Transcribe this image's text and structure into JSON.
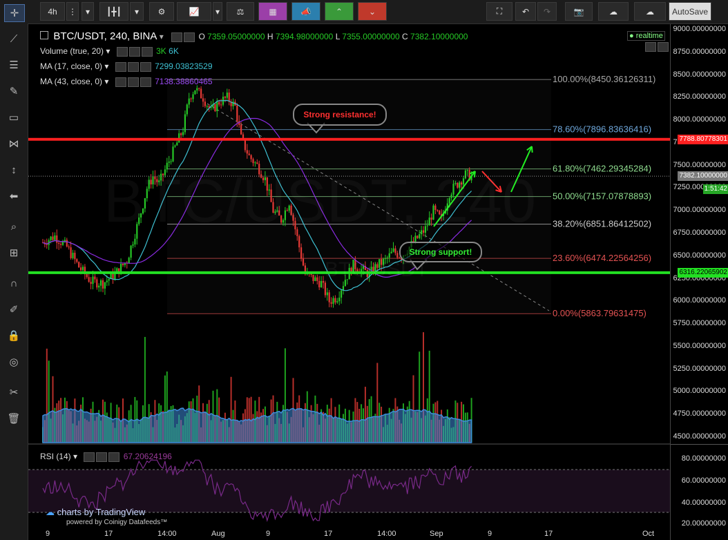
{
  "toolbar": {
    "interval": "4h",
    "autosave": "AutoSave"
  },
  "legend": {
    "symbol": "BTC/USDT, 240, BINA",
    "ohlc": {
      "o_label": "O",
      "o": "7359.05000000",
      "h_label": "H",
      "h": "7394.98000000",
      "l_label": "L",
      "l": "7355.00000000",
      "c_label": "C",
      "c": "7382.10000000"
    },
    "realtime": "realtime",
    "volume": "Volume (true, 20)",
    "volume_vals": [
      "3K",
      "6K"
    ],
    "ma17": "MA (17, close, 0)",
    "ma17_val": "7299.03823529",
    "ma43": "MA (43, close, 0)",
    "ma43_val": "7138.38860465",
    "rsi": "RSI (14)",
    "rsi_val": "67.20624196"
  },
  "watermark": "BTC/USDT, 240",
  "watermark_sub": "BTC/USDT",
  "branding": {
    "line1": "charts by TradingView",
    "line2": "powered by Coinigy Datafeeds™"
  },
  "annotations": {
    "resistance": "Strong resistance!",
    "support": "Strong support!"
  },
  "colors": {
    "up": "#26c926",
    "down": "#e53935",
    "resistance": "#ff2020",
    "support": "#22e022",
    "ma17": "#3ec1d3",
    "ma43": "#8a2be2",
    "rsi": "#7a2a8a",
    "fib_blue": "#6fa8dc",
    "fib_green": "#8fdc8f"
  },
  "chart_data": {
    "type": "candlestick",
    "symbol": "BTC/USDT",
    "interval": "240",
    "y_axis": {
      "min": 4500,
      "max": 9000,
      "step": 250,
      "ticks": [
        "9000.00000000",
        "8750.00000000",
        "8500.00000000",
        "8250.00000000",
        "8000.00000000",
        "7750.00000000",
        "7500.00000000",
        "7250.00000000",
        "7000.00000000",
        "6750.00000000",
        "6500.00000000",
        "6250.00000000",
        "6000.00000000",
        "5750.00000000",
        "5500.00000000",
        "5250.00000000",
        "5000.00000000",
        "4750.00000000",
        "4500.00000000"
      ]
    },
    "rsi_axis": {
      "ticks": [
        "80.00000000",
        "60.00000000",
        "40.00000000",
        "20.00000000"
      ],
      "upper": 70,
      "lower": 30
    },
    "x_ticks": [
      "9",
      "17",
      "14:00",
      "Aug",
      "9",
      "17",
      "14:00",
      "Sep",
      "9",
      "17",
      "Oct"
    ],
    "price_tags": [
      {
        "value": "7788.80778301",
        "color": "#ff2020"
      },
      {
        "value": "7382.10000000",
        "color": "#7a7a7a"
      },
      {
        "value": "1:51:42",
        "color": "#26a626"
      },
      {
        "value": "6316.22065902",
        "color": "#22e022"
      }
    ],
    "horizontal_lines": [
      {
        "name": "resistance",
        "value": 7788.81
      },
      {
        "name": "support",
        "value": 6316.22
      }
    ],
    "fib_levels": [
      {
        "label": "100.00%(8450.36126311)",
        "value": 8450.36,
        "color": "#aaaaaa"
      },
      {
        "label": "78.60%(7896.83636416)",
        "value": 7896.84,
        "color": "#6fa8dc"
      },
      {
        "label": "61.80%(7462.29345284)",
        "value": 7462.29,
        "color": "#8fdc8f"
      },
      {
        "label": "50.00%(7157.07878893)",
        "value": 7157.08,
        "color": "#8fdc8f"
      },
      {
        "label": "38.20%(6851.86412502)",
        "value": 6851.86,
        "color": "#cccccc"
      },
      {
        "label": "23.60%(6474.22564256)",
        "value": 6474.23,
        "color": "#e55353"
      },
      {
        "label": "0.00%(5863.79631475)",
        "value": 5863.8,
        "color": "#e55353"
      }
    ],
    "close_path": [
      [
        0,
        6650
      ],
      [
        6,
        6720
      ],
      [
        12,
        6600
      ],
      [
        18,
        6380
      ],
      [
        24,
        6220
      ],
      [
        30,
        6200
      ],
      [
        36,
        6300
      ],
      [
        42,
        6450
      ],
      [
        48,
        6900
      ],
      [
        52,
        7250
      ],
      [
        55,
        7380
      ],
      [
        58,
        7300
      ],
      [
        62,
        7500
      ],
      [
        66,
        7700
      ],
      [
        70,
        7900
      ],
      [
        73,
        8250
      ],
      [
        76,
        8350
      ],
      [
        80,
        8250
      ],
      [
        84,
        8100
      ],
      [
        88,
        8200
      ],
      [
        92,
        8250
      ],
      [
        96,
        8150
      ],
      [
        99,
        7800
      ],
      [
        103,
        7600
      ],
      [
        107,
        7500
      ],
      [
        111,
        7350
      ],
      [
        115,
        7000
      ],
      [
        119,
        6900
      ],
      [
        123,
        7100
      ],
      [
        127,
        6700
      ],
      [
        131,
        6300
      ],
      [
        135,
        6250
      ],
      [
        139,
        6200
      ],
      [
        143,
        6000
      ],
      [
        147,
        6050
      ],
      [
        151,
        6250
      ],
      [
        155,
        6400
      ],
      [
        159,
        6350
      ],
      [
        163,
        6300
      ],
      [
        167,
        6400
      ],
      [
        171,
        6450
      ],
      [
        175,
        6550
      ],
      [
        179,
        6500
      ],
      [
        183,
        6600
      ],
      [
        187,
        6700
      ],
      [
        191,
        6800
      ],
      [
        195,
        7000
      ],
      [
        199,
        6900
      ],
      [
        203,
        7200
      ],
      [
        207,
        7300
      ],
      [
        211,
        7400
      ],
      [
        214,
        7382
      ]
    ]
  }
}
